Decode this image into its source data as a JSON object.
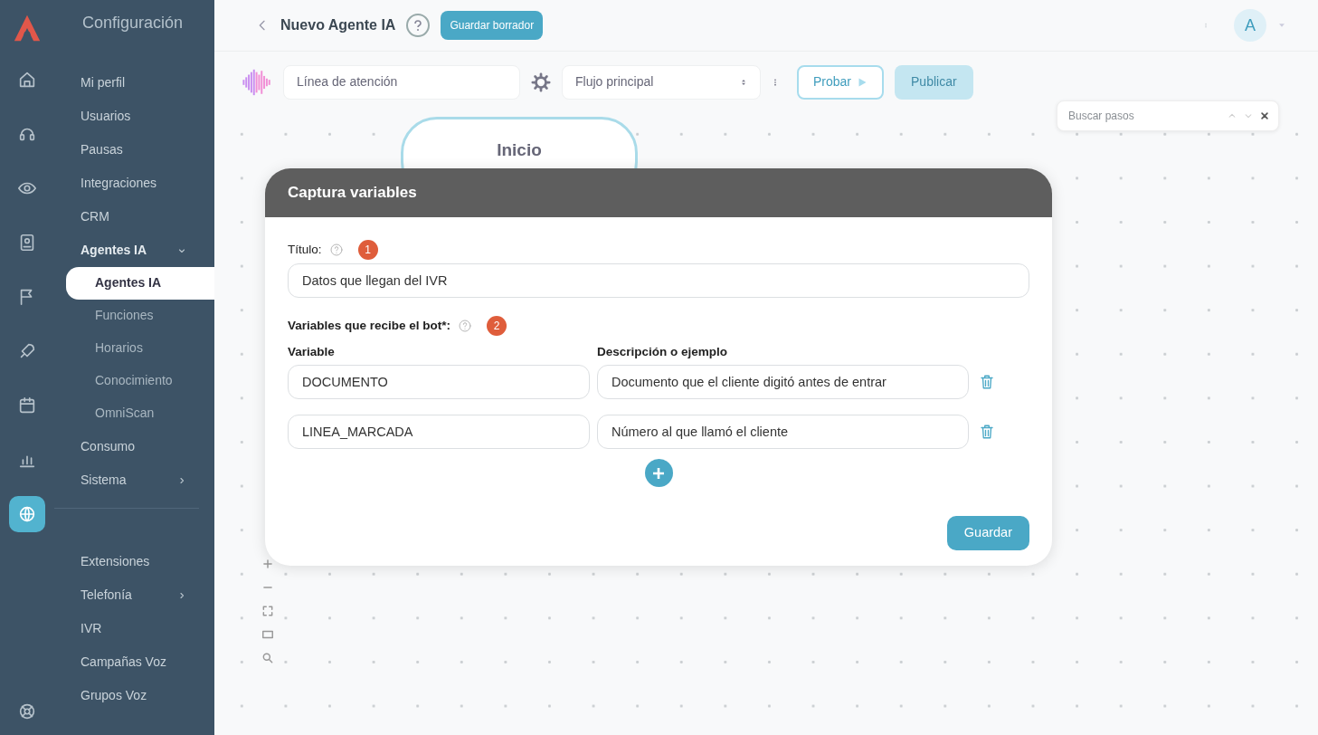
{
  "rail": [
    {
      "selected": false
    },
    {
      "selected": false
    },
    {
      "selected": false
    },
    {
      "selected": false
    },
    {
      "selected": false
    },
    {
      "selected": false
    },
    {
      "selected": false
    },
    {
      "selected": false
    },
    {
      "selected": true
    },
    {
      "selected": false
    }
  ],
  "settings_menu": {
    "title": "Configuración",
    "sections": [
      {
        "items": [
          {
            "label": "Mi perfil",
            "kind": "link"
          },
          {
            "label": "Usuarios",
            "kind": "link"
          },
          {
            "label": "Pausas",
            "kind": "link"
          },
          {
            "label": "Integraciones",
            "kind": "link"
          },
          {
            "label": "CRM",
            "kind": "link"
          },
          {
            "label": "Agentes IA",
            "kind": "group",
            "expanded": true,
            "children": [
              {
                "label": "Agentes IA",
                "selected": true
              },
              {
                "label": "Funciones",
                "selected": false
              },
              {
                "label": "Horarios",
                "selected": false
              },
              {
                "label": "Conocimiento",
                "selected": false
              },
              {
                "label": "OmniScan",
                "selected": false
              }
            ]
          },
          {
            "label": "Consumo",
            "kind": "link"
          },
          {
            "label": "Sistema",
            "kind": "group",
            "expanded": false
          }
        ]
      },
      {
        "items": [
          {
            "label": "Extensiones",
            "kind": "link"
          },
          {
            "label": "Telefonía",
            "kind": "group",
            "expanded": false
          },
          {
            "label": "IVR",
            "kind": "link"
          },
          {
            "label": "Campañas Voz",
            "kind": "link"
          },
          {
            "label": "Grupos Voz",
            "kind": "link"
          }
        ]
      }
    ]
  },
  "header": {
    "title": "Nuevo Agente IA",
    "draft_button": "Guardar borrador",
    "avatar": "A"
  },
  "toolbar": {
    "line_value": "Línea de atención",
    "flow_value": "Flujo principal",
    "test_button": "Probar",
    "publish_button": "Publicar",
    "publish_disabled": true
  },
  "canvas": {
    "start_node": "Inicio",
    "search_placeholder": "Buscar pasos"
  },
  "modal": {
    "title": "Captura variables",
    "title_label": "Título:",
    "title_step": "1",
    "title_value": "Datos que llegan del IVR",
    "variables_label": "Variables que recibe el bot*:",
    "variables_step": "2",
    "column_1": "Variable",
    "column_2": "Descripción o ejemplo",
    "variables": [
      {
        "name": "DOCUMENTO",
        "description": "Documento que el cliente digitó antes de entrar"
      },
      {
        "name": "LINEA_MARCADA",
        "description": "Número al que llamó el cliente"
      }
    ],
    "save_button": "Guardar"
  }
}
